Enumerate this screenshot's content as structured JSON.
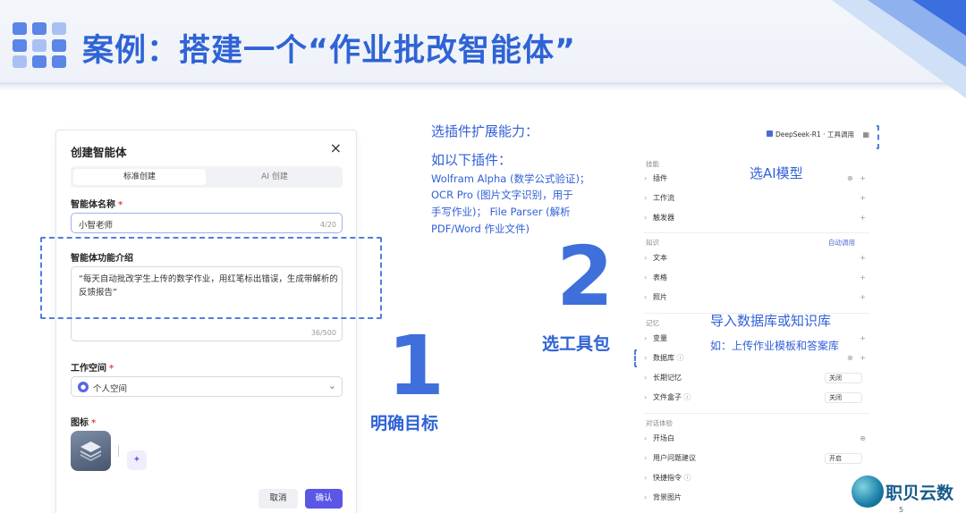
{
  "slide": {
    "title": "案例：搭建一个“作业批改智能体”"
  },
  "dialog": {
    "title": "创建智能体",
    "close": "×",
    "tabs": [
      "标准创建",
      "AI 创建"
    ],
    "name_label": "智能体名称",
    "required_mark": "*",
    "name_value": "小智老师",
    "name_count": "4/20",
    "desc_label": "智能体功能介绍",
    "desc_value": "“每天自动批改学生上传的数学作业，用红笔标出错误，生成带解析的反馈报告”",
    "desc_count": "36/500",
    "workspace_label": "工作空间",
    "workspace_value": "个人空间",
    "icon_label": "图标",
    "cancel": "取消",
    "confirm": "确认"
  },
  "steps": {
    "one_num": "1",
    "one_caption": "明确目标",
    "two_num": "2",
    "two_caption": "选工具包"
  },
  "plugins_note": {
    "heading": "选插件扩展能力：",
    "sub": "如以下插件：",
    "line1": "Wolfram Alpha (数学公式验证)；",
    "line2": "OCR Pro (图片文字识别，用于",
    "line3": "手写作业)； File Parser (解析",
    "line4": "PDF/Word 作业文件)"
  },
  "model_note": "选AI模型",
  "db_note": {
    "heading": "导入数据库或知识库",
    "sub": "如：上传作业模板和答案库"
  },
  "panel": {
    "model": "DeepSeek-R1 · 工具调用",
    "skills": "技能",
    "plugin": "插件",
    "workflow": "工作流",
    "trigger": "触发器",
    "knowledge": "知识",
    "auto_call": "自动调用",
    "text": "文本",
    "table": "表格",
    "photo": "照片",
    "memory": "记忆",
    "variable": "变量",
    "database": "数据库",
    "long_memory": "长期记忆",
    "file_box": "文件盒子",
    "off": "关闭",
    "dialog_exp": "对话体验",
    "opening": "开场白",
    "user_suggest": "用户问题建议",
    "on": "开启",
    "shortcut": "快捷指令",
    "bg_image": "背景图片"
  },
  "brand": "职贝云数",
  "page_num": "5",
  "colors": {
    "accent": "#2f63d6",
    "primary_button": "#5a56e6",
    "dash": "#4f7fdc"
  }
}
